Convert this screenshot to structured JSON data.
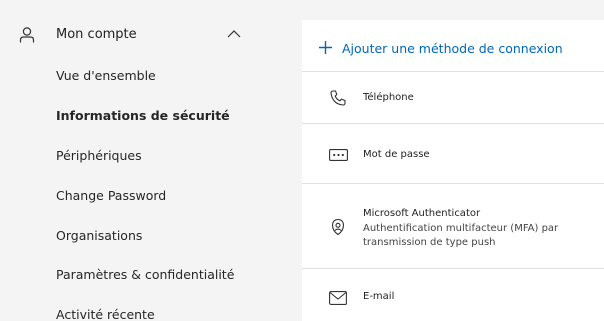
{
  "sidebar": {
    "account_label": "Mon compte",
    "items": [
      {
        "label": "Vue d'ensemble",
        "active": false
      },
      {
        "label": "Informations de sécurité",
        "active": true
      },
      {
        "label": "Périphériques",
        "active": false
      },
      {
        "label": "Change Password",
        "active": false
      },
      {
        "label": "Organisations",
        "active": false
      },
      {
        "label": "Paramètres & confidentialité",
        "active": false
      },
      {
        "label": "Activité récente",
        "active": false
      }
    ]
  },
  "main": {
    "add_method_label": "Ajouter une méthode de connexion",
    "methods": [
      {
        "icon": "phone-icon",
        "title": "Téléphone"
      },
      {
        "icon": "password-icon",
        "title": "Mot de passe"
      },
      {
        "icon": "authenticator-icon",
        "title": "Microsoft Authenticator",
        "description": "Authentification multifacteur (MFA) par transmission de type push"
      },
      {
        "icon": "email-icon",
        "title": "E-mail"
      }
    ]
  },
  "colors": {
    "accent": "#0067b8",
    "background": "#f4f4f4",
    "card": "#ffffff",
    "divider": "#e1e1e1"
  }
}
